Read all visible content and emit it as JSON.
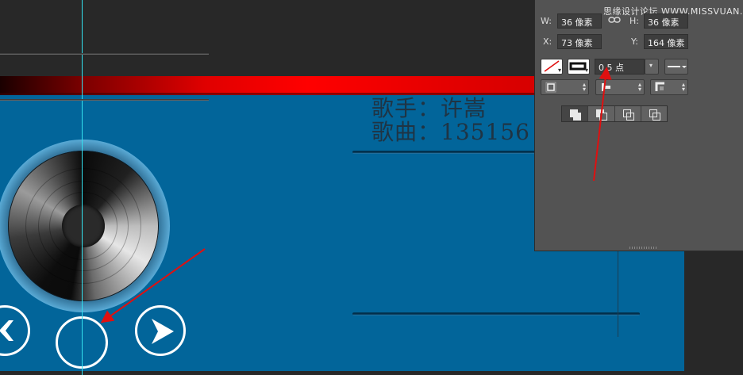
{
  "song": {
    "singer_line": "歌手：许嵩",
    "title_line": "歌曲：135156"
  },
  "properties": {
    "w_label": "W:",
    "w_value": "36 像素",
    "h_label": "H:",
    "h_value": "36 像素",
    "x_label": "X:",
    "x_value": "73 像素",
    "y_label": "Y:",
    "y_value": "164 像素",
    "stroke_width": "0.5 点",
    "link_icon": "link-icon"
  },
  "watermark": "思缘设计论坛 WWW.MISSVUAN.COM",
  "colors": {
    "artboard": "#02659a",
    "red_bar": "#ff0000",
    "guide": "#33e2ef",
    "annotation_arrow": "#e01010",
    "panel": "#535353"
  }
}
